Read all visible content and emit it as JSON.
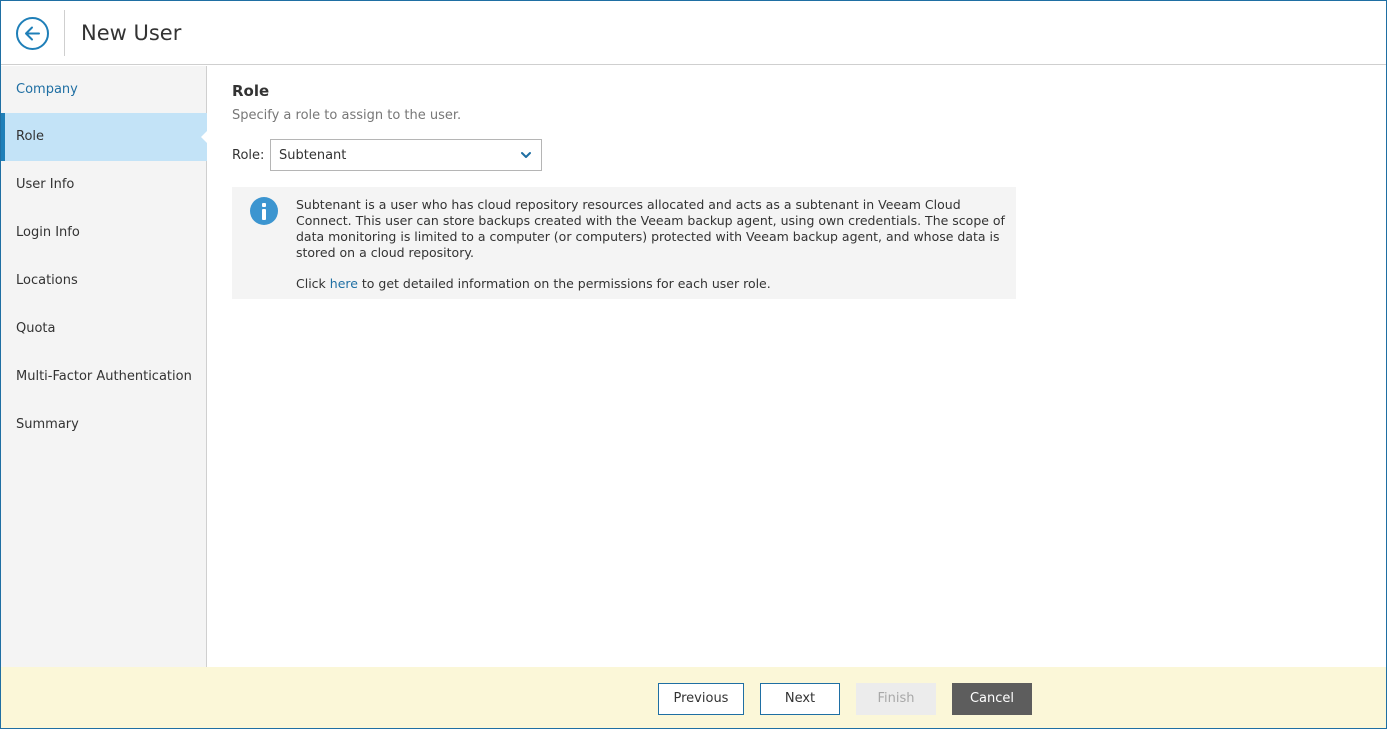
{
  "header": {
    "title": "New User"
  },
  "sidebar": {
    "items": [
      {
        "label": "Company"
      },
      {
        "label": "Role"
      },
      {
        "label": "User Info"
      },
      {
        "label": "Login Info"
      },
      {
        "label": "Locations"
      },
      {
        "label": "Quota"
      },
      {
        "label": "Multi-Factor Authentication"
      },
      {
        "label": "Summary"
      }
    ]
  },
  "main": {
    "title": "Role",
    "subtitle": "Specify a role to assign to the user.",
    "role_label": "Role:",
    "role_value": "Subtenant",
    "info": {
      "description": "Subtenant is a user who has cloud repository resources allocated and acts as a subtenant in Veeam Cloud Connect. This user can store backups created with the Veeam backup agent, using own credentials. The scope of data monitoring is limited to a computer (or computers) protected with Veeam backup agent, and whose data is stored on a cloud repository.",
      "link_prefix": "Click ",
      "link_text": "here",
      "link_suffix": " to get detailed information on the permissions for each user role."
    }
  },
  "footer": {
    "previous_label": "Previous",
    "next_label": "Next",
    "finish_label": "Finish",
    "cancel_label": "Cancel"
  },
  "colors": {
    "accent": "#1f6fa3",
    "active_nav_bg": "#c3e3f7",
    "info_icon": "#3c95d0",
    "footer_bg": "#fbf7d8",
    "cancel_bg": "#5d5d5d"
  }
}
